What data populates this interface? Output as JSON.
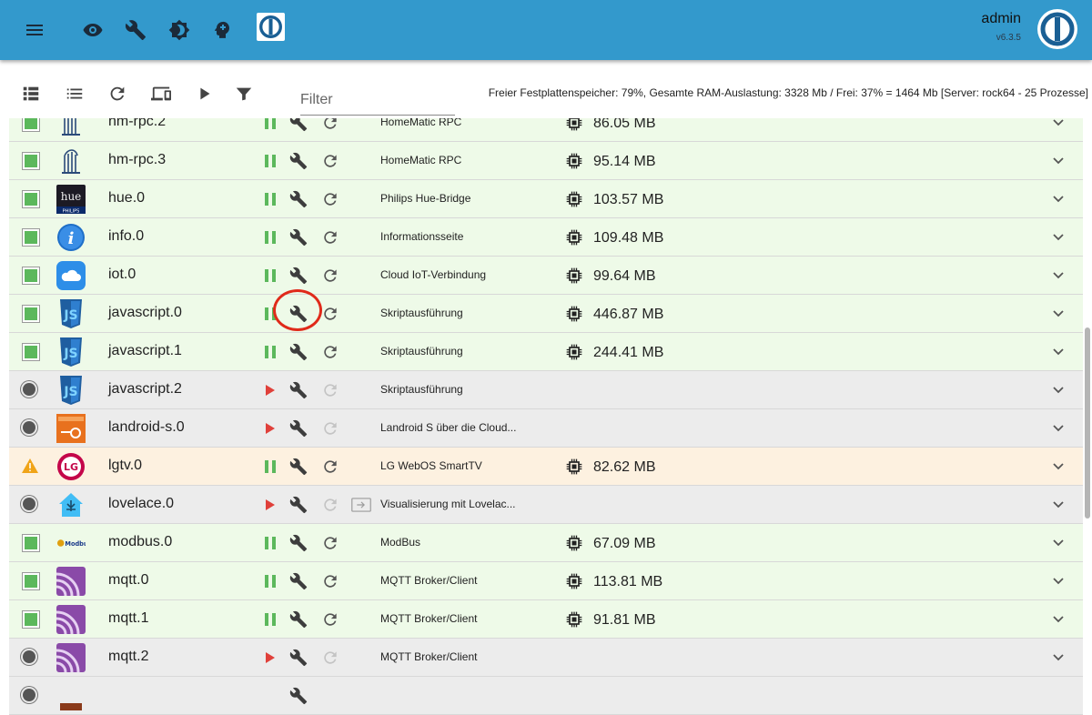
{
  "header": {
    "user": "admin",
    "version": "v6.3.5",
    "nav_icons": [
      "menu-icon",
      "eye-icon",
      "wrench-icon",
      "brightness-icon",
      "head-icon"
    ]
  },
  "toolbar": {
    "filter_placeholder": "Filter",
    "system_info": "Freier Festplattenspeicher: 79%, Gesamte RAM-Auslastung: 3328 Mb / Frei: 37% = 1464 Mb [Server: rock64 - 25 Prozesse]"
  },
  "colors": {
    "appbar": "#3399cc",
    "running_row": "#eefae8",
    "stopped_row": "#ececec",
    "warning_row": "#fdf1e0",
    "green_status": "#5cb85c",
    "play_red": "#e0403a",
    "highlight_red": "#e02a1a"
  },
  "adapters": [
    {
      "name": "hm-rpc.2",
      "desc": "HomeMatic RPC",
      "mem": "86.05 MB",
      "state": "running",
      "icon": "homematic"
    },
    {
      "name": "hm-rpc.3",
      "desc": "HomeMatic RPC",
      "mem": "95.14 MB",
      "state": "running",
      "icon": "homematic"
    },
    {
      "name": "hue.0",
      "desc": "Philips Hue-Bridge",
      "mem": "103.57 MB",
      "state": "running",
      "icon": "hue"
    },
    {
      "name": "info.0",
      "desc": "Informationsseite",
      "mem": "109.48 MB",
      "state": "running",
      "icon": "info"
    },
    {
      "name": "iot.0",
      "desc": "Cloud IoT-Verbindung",
      "mem": "99.64 MB",
      "state": "running",
      "icon": "cloud"
    },
    {
      "name": "javascript.0",
      "desc": "Skriptausführung",
      "mem": "446.87 MB",
      "state": "running",
      "icon": "js"
    },
    {
      "name": "javascript.1",
      "desc": "Skriptausführung",
      "mem": "244.41 MB",
      "state": "running",
      "icon": "js"
    },
    {
      "name": "javascript.2",
      "desc": "Skriptausführung",
      "mem": "",
      "state": "stopped",
      "icon": "js"
    },
    {
      "name": "landroid-s.0",
      "desc": "Landroid S über die Cloud...",
      "mem": "",
      "state": "stopped",
      "icon": "landroid"
    },
    {
      "name": "lgtv.0",
      "desc": "LG WebOS SmartTV",
      "mem": "82.62 MB",
      "state": "warning",
      "icon": "lg"
    },
    {
      "name": "lovelace.0",
      "desc": "Visualisierung mit Lovelac...",
      "mem": "",
      "state": "stopped",
      "icon": "lovelace",
      "link": true
    },
    {
      "name": "modbus.0",
      "desc": "ModBus",
      "mem": "67.09 MB",
      "state": "running",
      "icon": "modbus"
    },
    {
      "name": "mqtt.0",
      "desc": "MQTT Broker/Client",
      "mem": "113.81 MB",
      "state": "running",
      "icon": "mqtt"
    },
    {
      "name": "mqtt.1",
      "desc": "MQTT Broker/Client",
      "mem": "91.81 MB",
      "state": "running",
      "icon": "mqtt"
    },
    {
      "name": "mqtt.2",
      "desc": "MQTT Broker/Client",
      "mem": "",
      "state": "stopped",
      "icon": "mqtt"
    },
    {
      "name": "",
      "desc": "",
      "mem": "",
      "state": "stopped",
      "icon": "partial"
    }
  ]
}
